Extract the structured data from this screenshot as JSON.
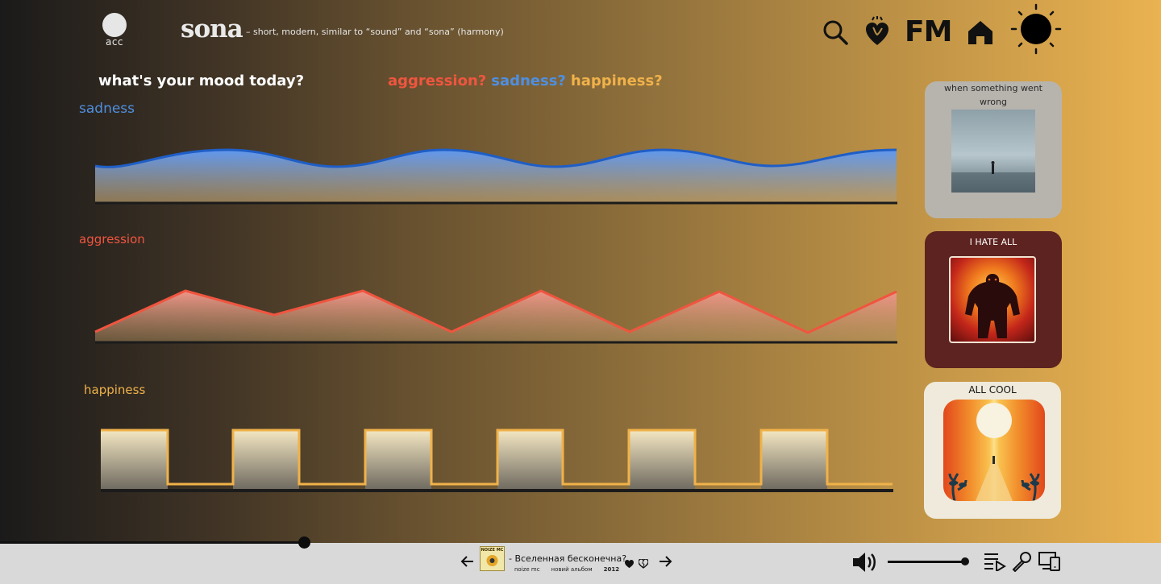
{
  "header": {
    "account_label": "acc",
    "logo": "sona",
    "tagline": "– short, modern, similar to “sound” and “sona” (harmony)",
    "icons": [
      "search-icon",
      "heart-hand-icon",
      "fm-icon",
      "home-icon",
      "theme-sun-icon"
    ],
    "fm_label": "FM"
  },
  "mood": {
    "question": "what's your mood today?",
    "options": [
      {
        "label": "aggression?",
        "color": "#f0553f"
      },
      {
        "label": "sadness?",
        "color": "#4f8fe0"
      },
      {
        "label": "happiness?",
        "color": "#f0b24a"
      }
    ]
  },
  "charts": {
    "sadness": {
      "label": "sadness",
      "color": "#4f8fe0",
      "shape": "sine wave"
    },
    "aggression": {
      "label": "aggression",
      "color": "#f0553f",
      "shape": "zigzag"
    },
    "happiness": {
      "label": "happiness",
      "color": "#f0b24a",
      "shape": "square wave"
    }
  },
  "playlists": [
    {
      "title": "when something went wrong",
      "bg": "#b7b4ad",
      "title_color": "#2a2a2a"
    },
    {
      "title": "I HATE ALL",
      "bg": "#5c2320",
      "title_color": "#ffffff"
    },
    {
      "title": "ALL COOL",
      "bg": "#efeadb",
      "title_color": "#111111"
    }
  ],
  "player": {
    "progress": 0.262,
    "track_title": "- Вселенная бесконечна?",
    "artist": "noize mc",
    "album": "новий альбом",
    "year": "2012",
    "cover_text": "NOIZE MC",
    "volume": 0.95,
    "icons": [
      "prev-arrow-icon",
      "like-heart-icon",
      "dislike-heart-icon",
      "next-arrow-icon",
      "volume-icon",
      "queue-icon",
      "microphone-icon",
      "devices-icon"
    ]
  }
}
